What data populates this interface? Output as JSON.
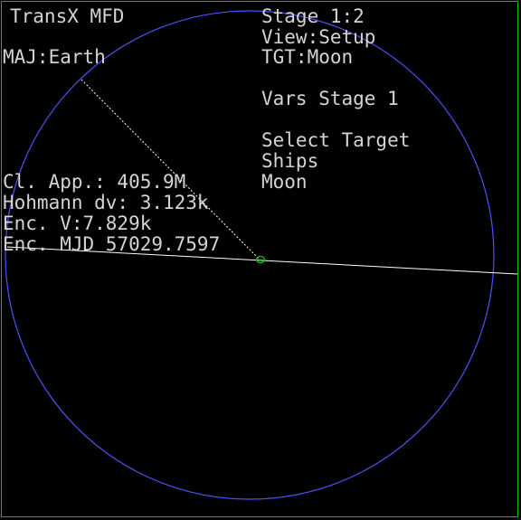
{
  "mfd": {
    "title": "TransX MFD",
    "major_body": "MAJ:Earth",
    "stage": "Stage 1:2",
    "view": "View:Setup",
    "target": "TGT:Moon",
    "vars_heading": "Vars Stage 1",
    "select_target_label": "Select Target",
    "target_options": [
      "Ships",
      "Moon"
    ],
    "readouts": {
      "closest_approach": "Cl. App.: 405.9M",
      "hohmann_dv": "Hohmann dv: 3.123k",
      "encounter_velocity": "Enc. V:7.829k",
      "encounter_mjd": "Enc. MJD 57029.7597"
    }
  },
  "colors": {
    "background": "#000000",
    "frame": "#00c800",
    "orbit": "#4a50ff",
    "text": "#d4d4d4",
    "vessel": "#00d000",
    "line": "#ffffff"
  }
}
